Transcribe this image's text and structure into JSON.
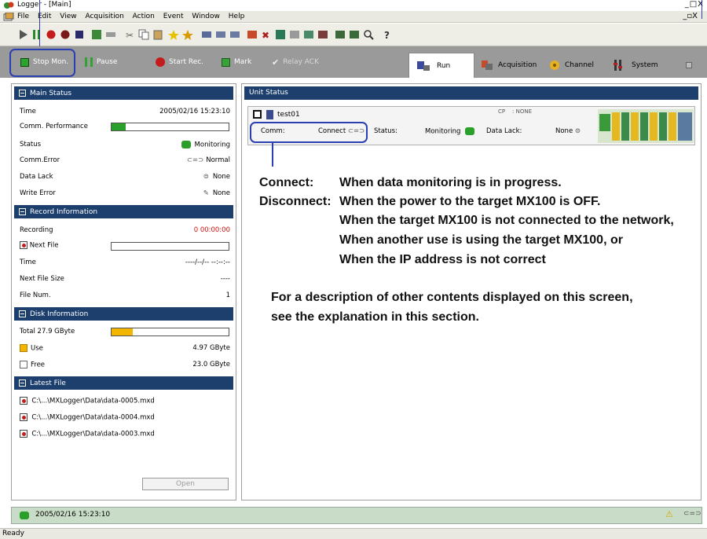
{
  "window": {
    "title": "Logger - [Main]",
    "controls": "_□X",
    "mdi_controls": "_▫X"
  },
  "menu": [
    "File",
    "Edit",
    "View",
    "Acquisition",
    "Action",
    "Event",
    "Window",
    "Help"
  ],
  "commands": {
    "stop_mon": "Stop Mon.",
    "pause": "Pause",
    "start_rec": "Start Rec.",
    "mark": "Mark",
    "relay_ack": "Relay ACK"
  },
  "tabs": {
    "run": "Run",
    "acquisition": "Acquisition",
    "channel": "Channel",
    "system": "System"
  },
  "main_status": {
    "header": "Main Status",
    "time_label": "Time",
    "time_value": "2005/02/16 15:23:10",
    "comm_perf_label": "Comm. Performance",
    "comm_perf_level": 0.12,
    "status_label": "Status",
    "status_value": "Monitoring",
    "comm_error_label": "Comm.Error",
    "comm_error_value": "Normal",
    "data_lack_label": "Data Lack",
    "data_lack_value": "None",
    "write_error_label": "Write Error",
    "write_error_value": "None"
  },
  "record_info": {
    "header": "Record Information",
    "recording_label": "Recording",
    "recording_value": "0 00:00:00",
    "next_file_label": "Next File",
    "time_label": "Time",
    "time_value": "----/--/-- --:--:--",
    "next_file_size_label": "Next File Size",
    "next_file_size_value": "----",
    "file_num_label": "File Num.",
    "file_num_value": "1"
  },
  "disk_info": {
    "header": "Disk Information",
    "total_label": "Total 27.9 GByte",
    "use_fraction": 0.18,
    "use_label": "Use",
    "use_value": "4.97 GByte",
    "free_label": "Free",
    "free_value": "23.0 GByte"
  },
  "latest_file": {
    "header": "Latest File",
    "files": [
      "C:\\...\\MXLogger\\Data\\data-0005.mxd",
      "C:\\...\\MXLogger\\Data\\data-0004.mxd",
      "C:\\...\\MXLogger\\Data\\data-0003.mxd"
    ],
    "open_label": "Open"
  },
  "unit_status": {
    "header": "Unit Status",
    "unit_name": "test01",
    "cp_label": "CP",
    "cp_value": ": NONE",
    "comm_label": "Comm:",
    "comm_value": "Connect",
    "status_label": "Status:",
    "status_value": "Monitoring",
    "data_lack_label": "Data Lack:",
    "data_lack_value": "None"
  },
  "annotation": {
    "connect_term": "Connect:",
    "connect_desc": "When data monitoring is in progress.",
    "disconnect_term": "Disconnect:",
    "disconnect_lines": [
      "When the power to the target MX100 is OFF.",
      "When the target MX100 is not connected to the network,",
      "When another use is using the target MX100, or",
      "When the IP address is not correct"
    ],
    "note_lines": [
      "For a description of other contents displayed on this screen,",
      "see the explanation in this section."
    ]
  },
  "status_strip": {
    "time": "2005/02/16 15:23:10"
  },
  "statusbar": {
    "text": "Ready"
  },
  "colors": {
    "section_header": "#1d3f6e",
    "highlight": "#2a3fb0",
    "command_bar": "#9a9a9a"
  }
}
